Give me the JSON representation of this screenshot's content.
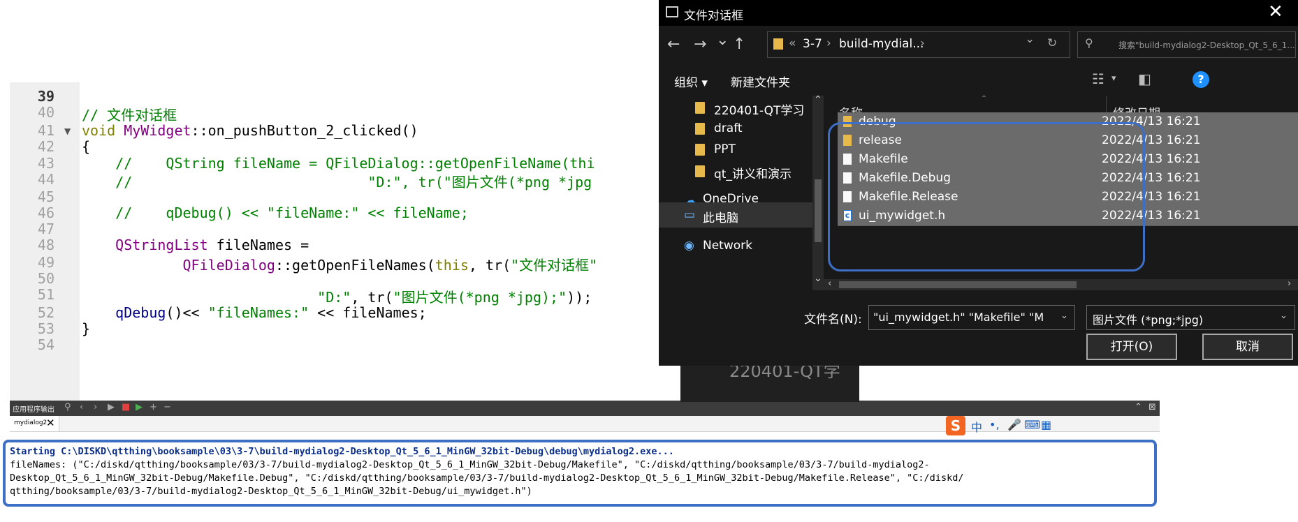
{
  "editor": {
    "lines": [
      {
        "num": "39",
        "current": true,
        "text": "",
        "fold": ""
      },
      {
        "num": "40",
        "text": "// 文件对话框",
        "fold": ""
      },
      {
        "num": "41",
        "text": "void MyWidget::on_pushButton_2_clicked()",
        "fold": "▼"
      },
      {
        "num": "42",
        "text": "{",
        "fold": ""
      },
      {
        "num": "43",
        "text": "    //    QString fileName = QFileDialog::getOpenFileName(thi",
        "fold": ""
      },
      {
        "num": "44",
        "text": "    //                            \"D:\", tr(\"图片文件(*png *jpg",
        "fold": ""
      },
      {
        "num": "45",
        "text": "",
        "fold": ""
      },
      {
        "num": "46",
        "text": "    //    qDebug() << \"fileName:\" << fileName;",
        "fold": ""
      },
      {
        "num": "47",
        "text": "",
        "fold": ""
      },
      {
        "num": "48",
        "text": "    QStringList fileNames =",
        "fold": ""
      },
      {
        "num": "49",
        "text": "            QFileDialog::getOpenFileNames(this, tr(\"文件对话框\"",
        "fold": ""
      },
      {
        "num": "50",
        "text": "",
        "fold": ""
      },
      {
        "num": "51",
        "text": "                            \"D:\", tr(\"图片文件(*png *jpg);\"));",
        "fold": ""
      },
      {
        "num": "52",
        "text": "    qDebug()<< \"fileNames:\" << fileNames;",
        "fold": ""
      },
      {
        "num": "53",
        "text": "}",
        "fold": ""
      },
      {
        "num": "54",
        "text": "",
        "fold": ""
      }
    ]
  },
  "output_pane": {
    "toolbar_label": "应用程序输出",
    "tab_label": "mydialog2",
    "close_icon": "✕",
    "start_line": "Starting C:\\DISKD\\qtthing\\booksample\\03\\3-7\\build-mydialog2-Desktop_Qt_5_6_1_MinGW_32bit-Debug\\debug\\mydialog2.exe...",
    "result_lines": [
      "fileNames: (\"C:/diskd/qtthing/booksample/03/3-7/build-mydialog2-Desktop_Qt_5_6_1_MinGW_32bit-Debug/Makefile\", \"C:/diskd/qtthing/booksample/03/3-7/build-mydialog2-",
      "Desktop_Qt_5_6_1_MinGW_32bit-Debug/Makefile.Debug\", \"C:/diskd/qtthing/booksample/03/3-7/build-mydialog2-Desktop_Qt_5_6_1_MinGW_32bit-Debug/Makefile.Release\", \"C:/diskd/",
      "qtthing/booksample/03/3-7/build-mydialog2-Desktop_Qt_5_6_1_MinGW_32bit-Debug/ui_mywidget.h\")"
    ]
  },
  "ime": {
    "logo": "S",
    "mode": "中",
    "punct": "•,",
    "mic": "🎤",
    "keyboard": "⌨",
    "grid": "▦"
  },
  "background_window": {
    "folder_label": "220401-QT学"
  },
  "dialog": {
    "title": "文件对话框",
    "close": "✕",
    "nav": {
      "back": "←",
      "forward": "→",
      "recent": "⌄",
      "up": "↑"
    },
    "address": {
      "overflow": "«",
      "crumbs": [
        "3-7",
        "build-mydial..."
      ],
      "refresh": "↻",
      "dropdown": "⌄"
    },
    "search_placeholder": "搜索\"build-mydialog2-Desktop_Qt_5_6_1...",
    "commands": {
      "organize": "组织 ▾",
      "new_folder": "新建文件夹",
      "view_icon": "☷",
      "view_caret": "▾",
      "help": "?"
    },
    "nav_items": [
      {
        "label": "220401-QT学习",
        "kind": "folder"
      },
      {
        "label": "draft",
        "kind": "folder"
      },
      {
        "label": "PPT",
        "kind": "folder"
      },
      {
        "label": "qt_讲义和演示",
        "kind": "folder"
      },
      {
        "label": "OneDrive",
        "kind": "cloud"
      },
      {
        "label": "此电脑",
        "kind": "pc",
        "selected": true
      },
      {
        "label": "Network",
        "kind": "network"
      }
    ],
    "columns": {
      "name": "名称",
      "modified": "修改日期"
    },
    "files": [
      {
        "name": "debug",
        "type": "folder",
        "date": "2022/4/13 16:21"
      },
      {
        "name": "release",
        "type": "folder",
        "date": "2022/4/13 16:21"
      },
      {
        "name": "Makefile",
        "type": "file",
        "date": "2022/4/13 16:21"
      },
      {
        "name": "Makefile.Debug",
        "type": "file",
        "date": "2022/4/13 16:21"
      },
      {
        "name": "Makefile.Release",
        "type": "file",
        "date": "2022/4/13 16:21"
      },
      {
        "name": "ui_mywidget.h",
        "type": "hfile",
        "date": "2022/4/13 16:21"
      }
    ],
    "filename_label": "文件名(N):",
    "filename_value": "\"ui_mywidget.h\" \"Makefile\" \"M",
    "filter_value": "图片文件 (*png;*jpg)",
    "open_button": "打开(O)",
    "cancel_button": "取消"
  },
  "colors": {
    "highlight_box": "#3d6fc7",
    "selected_row": "#6b6b6b",
    "dialog_bg": "#191919"
  }
}
